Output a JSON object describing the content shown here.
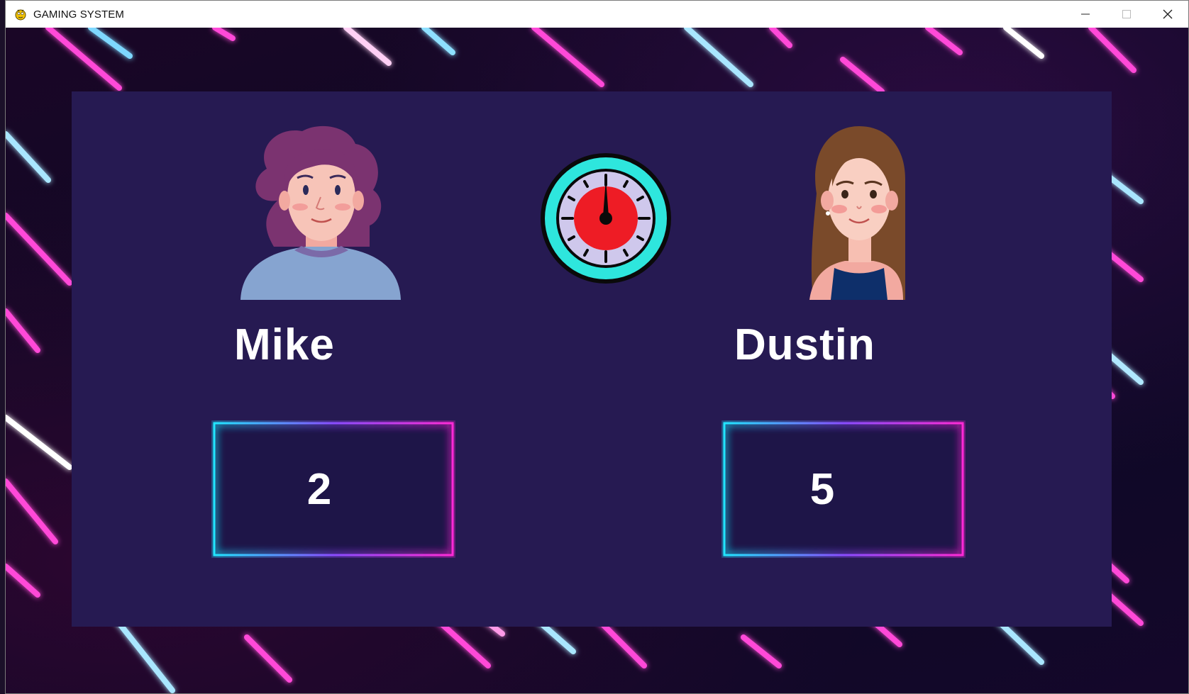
{
  "window": {
    "title": "GAMING SYSTEM",
    "controls": [
      "minimize-icon",
      "maximize-icon",
      "close-icon"
    ]
  },
  "players": [
    {
      "name": "Mike",
      "score": "2",
      "avatar": "curly-hair-person-avatar"
    },
    {
      "name": "Dustin",
      "score": "5",
      "avatar": "long-hair-girl-avatar"
    }
  ],
  "timer": {
    "icon": "stopwatch-icon",
    "ring_color": "#2ee6dd",
    "face_color": "#cfc8ec",
    "dial_color": "#ee1c25"
  },
  "colors": {
    "panel": "#261a52",
    "neon_cyan": "#22e6ff",
    "neon_magenta": "#ff2bd6",
    "text": "#ffffff"
  }
}
